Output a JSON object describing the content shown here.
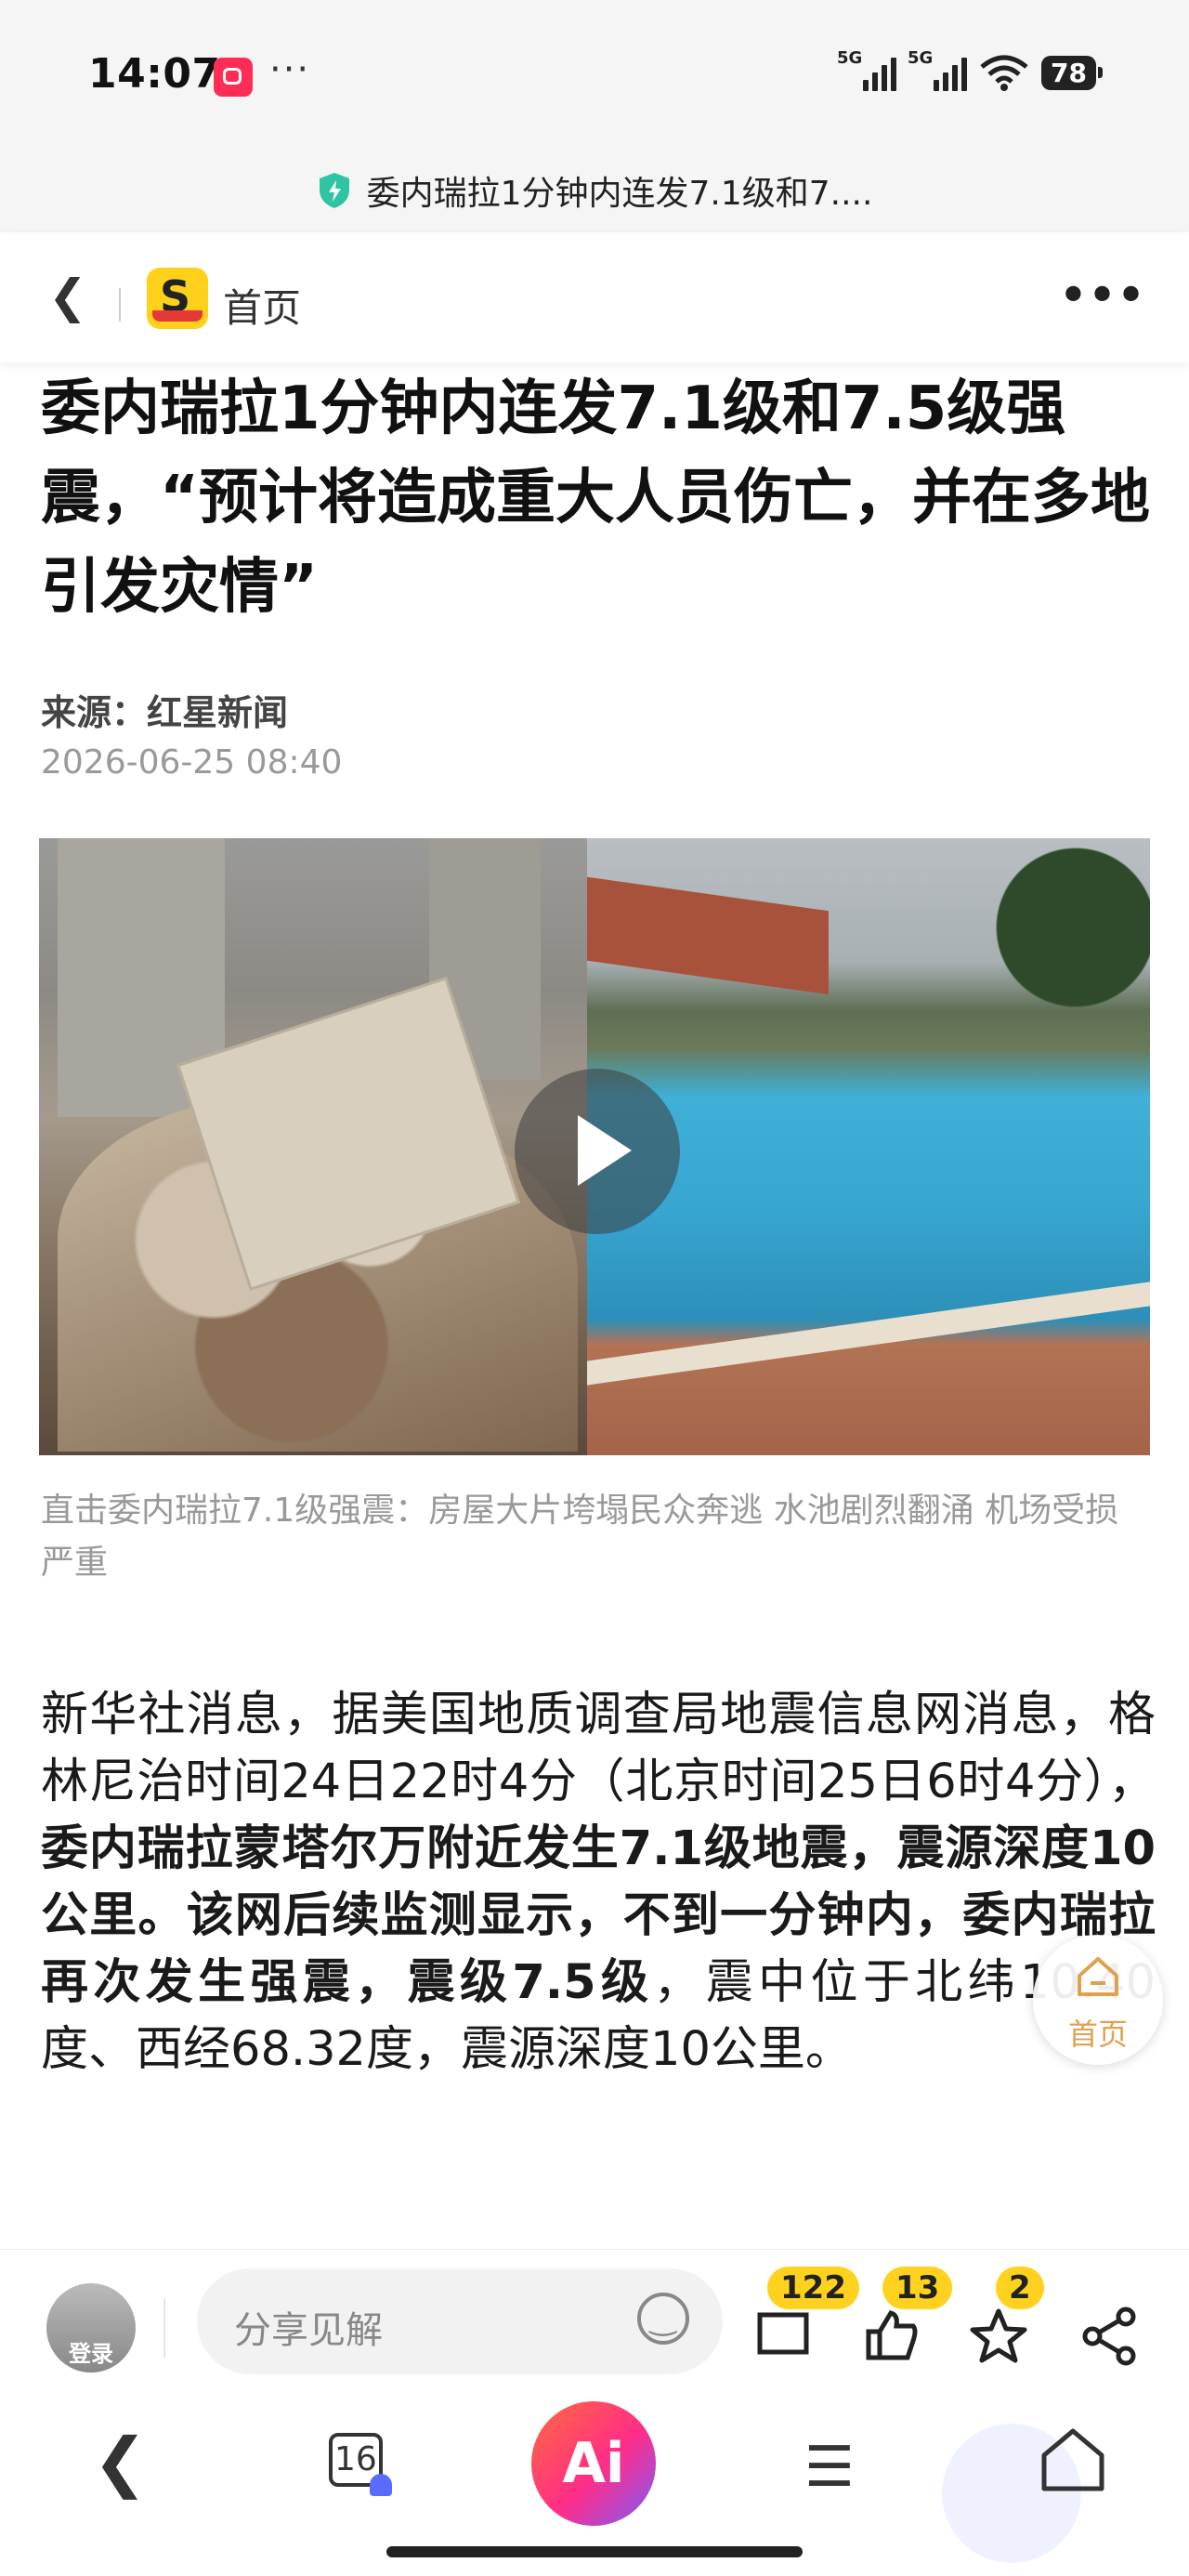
{
  "status_bar": {
    "time": "14:07",
    "dots": "···",
    "signal_1": "5G",
    "signal_2": "5G",
    "battery": "78"
  },
  "url_bar": {
    "text": "委内瑞拉1分钟内连发7.1级和7...."
  },
  "nav": {
    "home_label": "首页",
    "more": "•••"
  },
  "article": {
    "title": "委内瑞拉1分钟内连发7.1级和7.5级强震，“预计将造成重大人员伤亡，并在多地引发灾情”",
    "source": "来源：红星新闻",
    "date": "2026-06-25 08:40",
    "video_caption": "直击委内瑞拉7.1级强震：房屋大片垮塌民众奔逃 水池剧烈翻涌 机场受损严重",
    "body_part1": "新华社消息，据美国地质调查局地震信息网消息，格林尼治时间24日22时4分（北京时间25日6时4分），",
    "body_bold1": "委内瑞拉蒙塔尔万附近发生7.1级地震，震源深度10公里。该网后续监测显示，不到一分钟内，委内瑞拉再次发生强震，震级7.5级",
    "body_part2": "，震中位于北纬10.40度、西经68.32度，震源深度10公里。"
  },
  "float_button": {
    "label": "首页"
  },
  "action_bar": {
    "login": "登录",
    "comment_placeholder": "分享见解",
    "comments_count": "122",
    "likes_count": "13",
    "favorites_count": "2"
  },
  "bottom_nav": {
    "tabs_count": "16",
    "ai_label": "Ai"
  }
}
